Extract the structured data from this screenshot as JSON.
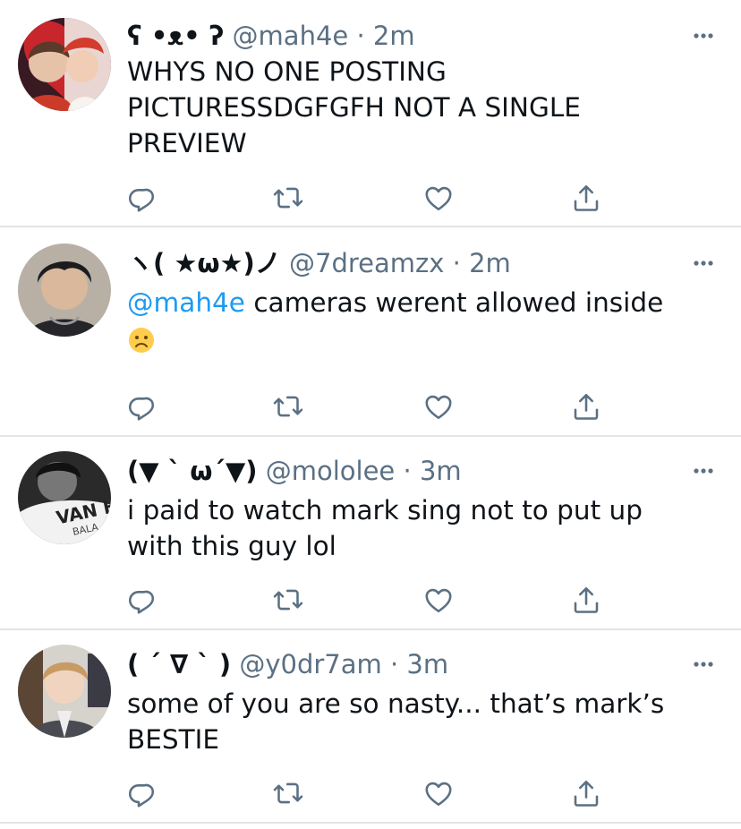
{
  "tweets": [
    {
      "display_name": "ʕ •ᴥ• ʔ",
      "handle": "@mah4e",
      "separator": "·",
      "time": "2m",
      "text": "WHYS NO ONE POSTING PICTURESSDGFGFH NOT A SINGLE PREVIEW",
      "mention": ""
    },
    {
      "display_name": "ヽ( ★ω★)ノ",
      "handle": "@7dreamzx",
      "separator": "·",
      "time": "2m",
      "mention": "@mah4e",
      "text": " cameras werent allowed inside",
      "emoji": "frowning-face"
    },
    {
      "display_name": "(▼ ` ω´▼)",
      "handle": "@mololee",
      "separator": "·",
      "time": "3m",
      "text": "i paid to watch mark sing not to put up with this guy lol",
      "mention": ""
    },
    {
      "display_name": "( ´ ∇ ` )",
      "handle": "@y0dr7am",
      "separator": "·",
      "time": "3m",
      "text": "some of you are so nasty... that’s mark’s BESTIE",
      "mention": ""
    }
  ],
  "icons": {
    "reply": "reply-icon",
    "retweet": "retweet-icon",
    "like": "like-icon",
    "share": "share-icon",
    "more": "more-options-icon"
  },
  "colors": {
    "text": "#0f1419",
    "secondary": "#5b7083",
    "mention": "#1d9bf0",
    "divider": "#e1e4e8"
  }
}
